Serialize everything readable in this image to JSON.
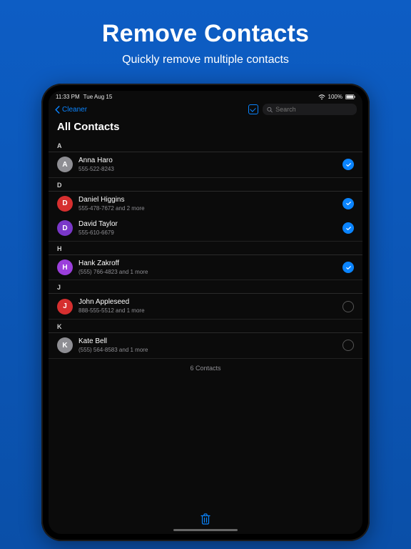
{
  "promo": {
    "title": "Remove Contacts",
    "subtitle": "Quickly remove multiple contacts"
  },
  "status": {
    "time": "11:33 PM",
    "date": "Tue Aug 15",
    "battery": "100%"
  },
  "nav": {
    "back_label": "Cleaner",
    "search_placeholder": "Search"
  },
  "page_title": "All Contacts",
  "sections": [
    {
      "letter": "A"
    },
    {
      "letter": "D"
    },
    {
      "letter": "H"
    },
    {
      "letter": "J"
    },
    {
      "letter": "K"
    }
  ],
  "contacts": {
    "a0": {
      "initial": "A",
      "color": "#8e8e93",
      "name": "Anna Haro",
      "sub": "555-522-8243",
      "selected": true
    },
    "d0": {
      "initial": "D",
      "color": "#d62f2f",
      "name": "Daniel Higgins",
      "sub": "555-478-7672 and 2 more",
      "selected": true
    },
    "d1": {
      "initial": "D",
      "color": "#7a37c9",
      "name": "David Taylor",
      "sub": "555-610-6679",
      "selected": true
    },
    "h0": {
      "initial": "H",
      "color": "#9b3fdb",
      "name": "Hank Zakroff",
      "sub": "(555) 766-4823 and 1 more",
      "selected": true
    },
    "j0": {
      "initial": "J",
      "color": "#d62f2f",
      "name": "John Appleseed",
      "sub": "888-555-5512 and 1 more",
      "selected": false
    },
    "k0": {
      "initial": "K",
      "color": "#8e8e93",
      "name": "Kate Bell",
      "sub": "(555) 564-8583 and 1 more",
      "selected": false
    }
  },
  "footer_count": "6 Contacts"
}
